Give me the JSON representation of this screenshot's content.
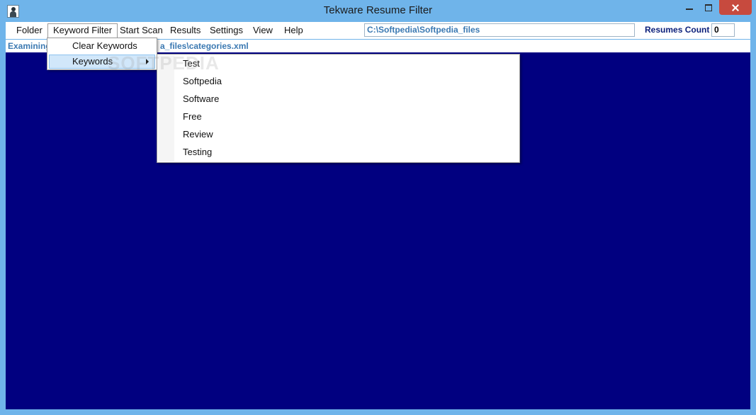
{
  "window": {
    "title": "Tekware Resume Filter",
    "icon": "person-portrait-icon"
  },
  "menubar": {
    "items": [
      "Folder",
      "Keyword Filter",
      "Start Scan",
      "Results",
      "Settings",
      "View",
      "Help"
    ],
    "open_item": "Keyword Filter"
  },
  "toolbar": {
    "path_value": "C:\\Softpedia\\Softpedia_files",
    "count_label": "Resumes Count",
    "count_value": "0"
  },
  "status": {
    "left_text": "Examining",
    "right_text": "a_files\\categories.xml"
  },
  "keyword_menu": {
    "items": [
      "Clear Keywords",
      "Keywords"
    ],
    "highlighted": "Keywords"
  },
  "keywords_submenu": {
    "items": [
      "Test",
      "Softpedia",
      "Software",
      "Free",
      "Review",
      "Testing"
    ]
  },
  "watermark": "SOFTPEDIA",
  "colors": {
    "content_bg": "#010080",
    "frame": "#6fb4ea",
    "path_text": "#3b79b2",
    "label_text": "#0b1f7a",
    "close_button": "#c74a3e",
    "highlight": "#d1e7fa"
  }
}
